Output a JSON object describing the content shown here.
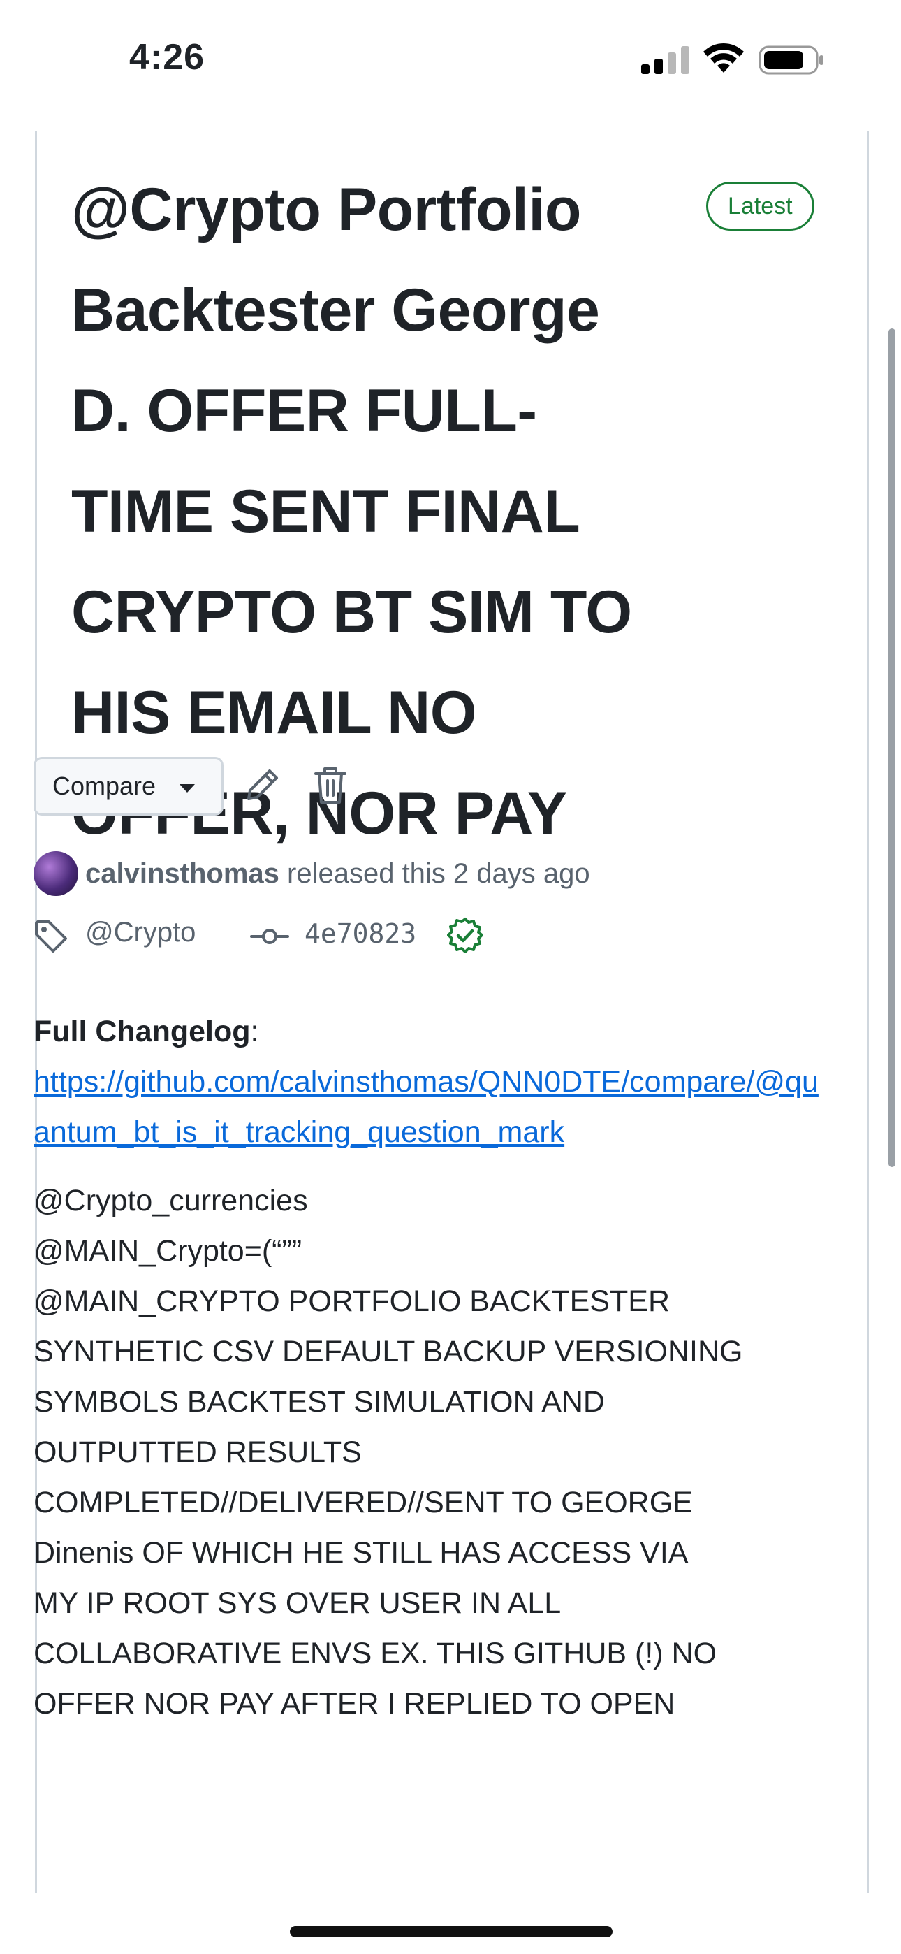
{
  "status_bar": {
    "time": "4:26"
  },
  "release": {
    "title": "@Crypto Portfolio Backtester George D. OFFER FULL-TIME SENT FINAL CRYPTO BT SIM TO HIS EMAIL NO OFFER, NOR PAY",
    "title_lines": [
      "@Crypto Portfolio",
      "Backtester George",
      "D. OFFER FULL-",
      "TIME SENT FINAL",
      "CRYPTO BT SIM TO",
      "HIS EMAIL NO",
      "OFFER, NOR PAY"
    ],
    "badge": "Latest",
    "compare_label": "Compare",
    "author": "calvinsthomas",
    "released_text": "released this 2 days ago",
    "tag": "@Crypto",
    "commit": "4e70823",
    "changelog_label": "Full Changelog",
    "changelog_link": "https://github.com/calvinsthomas/QNN0DTE/compare/@quantum_bt_is_it_tracking_question_mark",
    "body_lines": [
      "@Crypto_currencies",
      "@MAIN_Crypto=(“””",
      "@MAIN_CRYPTO PORTFOLIO BACKTESTER",
      "SYNTHETIC CSV DEFAULT BACKUP VERSIONING",
      "SYMBOLS BACKTEST SIMULATION AND",
      "OUTPUTTED RESULTS",
      "COMPLETED//DELIVERED//SENT TO GEORGE",
      "Dinenis OF WHICH HE STILL HAS ACCESS VIA",
      "MY IP ROOT SYS OVER USER IN ALL",
      "COLLABORATIVE ENVS EX. THIS GITHUB (!) NO",
      "OFFER NOR PAY AFTER I REPLIED TO OPEN"
    ]
  },
  "colors": {
    "accent_link": "#0969da",
    "success_green": "#1a7f37",
    "muted_text": "#59636e",
    "border": "#d0d7de"
  }
}
